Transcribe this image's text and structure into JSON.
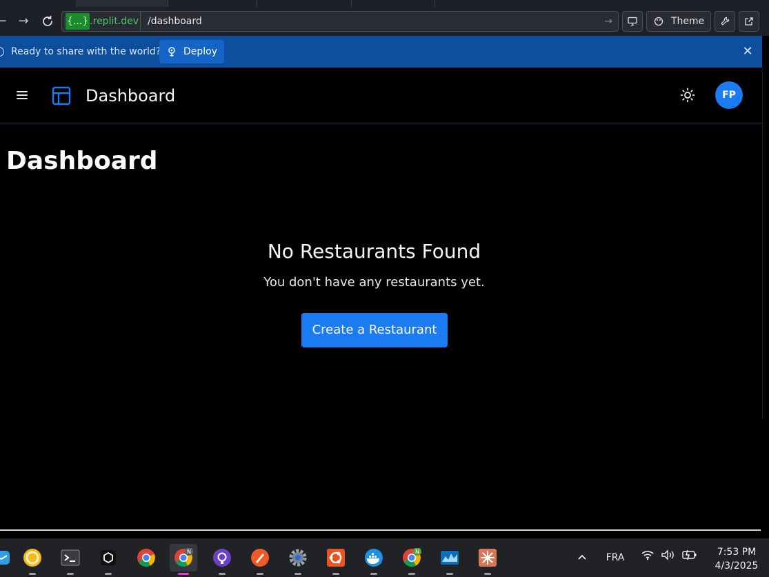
{
  "browser": {
    "url_domain_highlight": "{...}",
    "url_domain_rest": ".replit.dev",
    "url_path": "/dashboard",
    "theme_label": "Theme"
  },
  "banner": {
    "message": "Ready to share with the world?",
    "deploy_label": "Deploy",
    "close_glyph": "✕"
  },
  "header": {
    "title": "Dashboard",
    "avatar_initials": "FP"
  },
  "main": {
    "page_title": "Dashboard",
    "empty_title": "No Restaurants Found",
    "empty_message": "You don't have any restaurants yet.",
    "create_label": "Create a Restaurant"
  },
  "taskbar": {
    "language": "FRA",
    "time": "7:53 PM",
    "date": "4/3/2025",
    "apps": [
      "mail-icon",
      "circle-app-icon",
      "terminal-icon",
      "box-app-icon",
      "chrome-icon",
      "chrome-n-icon",
      "github-icon",
      "paw-app-icon",
      "settings-icon",
      "ubuntu-icon",
      "docker-icon",
      "chrome-n-green-icon",
      "monitor-chart-icon",
      "claude-icon"
    ]
  },
  "colors": {
    "accent": "#1a7cf0",
    "banner": "#0d4f9e",
    "url_green": "#4fc96a"
  }
}
